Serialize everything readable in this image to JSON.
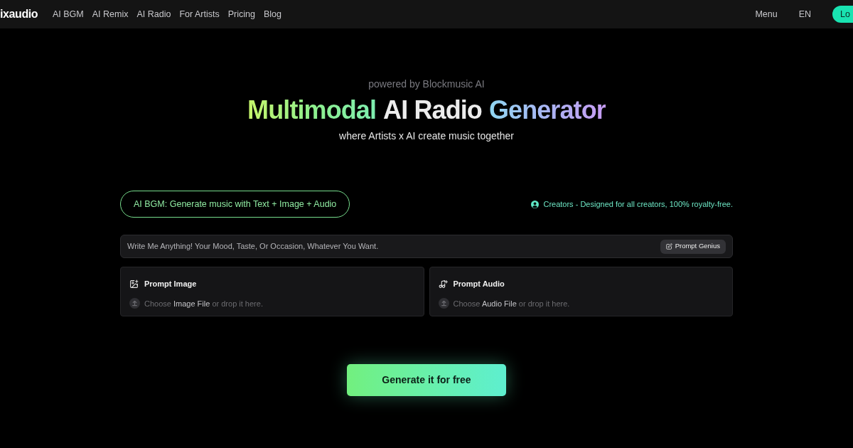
{
  "nav": {
    "logo": "ixaudio",
    "links": [
      "AI BGM",
      "AI Remix",
      "AI Radio",
      "For Artists",
      "Pricing",
      "Blog"
    ],
    "right_links": [
      "Menu",
      "EN"
    ],
    "login": "Lo"
  },
  "hero": {
    "eyebrow": "powered by Blockmusic AI",
    "title": [
      {
        "text": "Multimodal",
        "kind": "green"
      },
      {
        "text": "AI Radio",
        "kind": "plain"
      },
      {
        "text": "Generator",
        "kind": "violet"
      }
    ],
    "subtitle": "where Artists x AI create music together"
  },
  "mode_pill": "AI BGM: Generate music with Text + Image + Audio",
  "tagline": "Creators - Designed for all creators, 100% royalty-free.",
  "prompt": {
    "placeholder": "Write Me Anything! Your Mood, Taste, Or Occasion, Whatever You Want.",
    "button": "Prompt Genius"
  },
  "uploads": [
    {
      "kind": "image",
      "title": "Prompt Image",
      "hint": "Choose **Image File** or drop it here."
    },
    {
      "kind": "audio",
      "title": "Prompt Audio",
      "hint": "Choose **Audio File** or drop it here."
    }
  ],
  "cta": "Generate it for free"
}
